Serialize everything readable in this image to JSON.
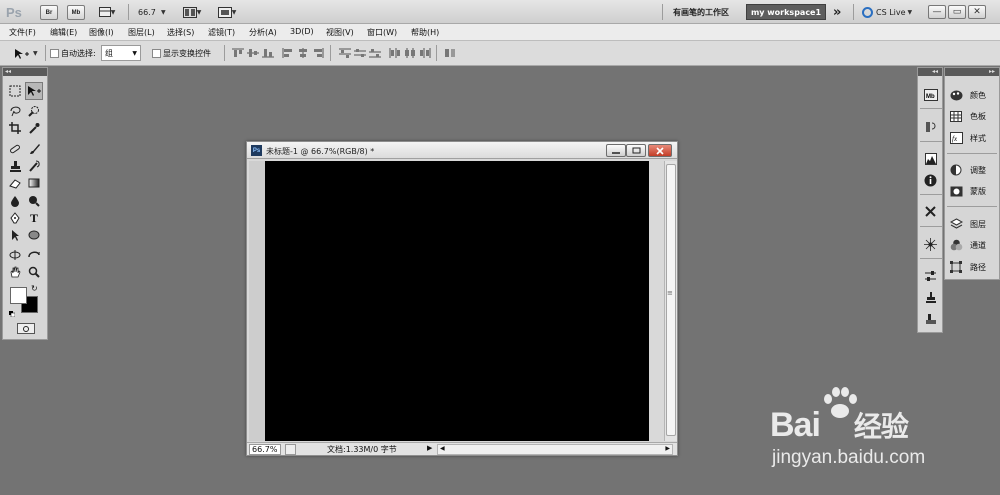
{
  "app": {
    "logo": "Ps",
    "bridge_label": "Br",
    "minibridge_label": "Mb",
    "zoom_value": "66.7",
    "workspace_link": "有画笔的工作区",
    "workspace_active": "my workspace1",
    "more_label": "»",
    "cs_live": "CS Live",
    "window_controls": [
      "—",
      "▭",
      "✕"
    ]
  },
  "menu": {
    "items": [
      "文件(F)",
      "编辑(E)",
      "图像(I)",
      "图层(L)",
      "选择(S)",
      "滤镜(T)",
      "分析(A)",
      "3D(D)",
      "视图(V)",
      "窗口(W)",
      "帮助(H)"
    ]
  },
  "options": {
    "auto_select_label": "自动选择:",
    "auto_select_value": "组",
    "transform_label": "显示变换控件"
  },
  "right_panel": {
    "items": [
      "颜色",
      "色板",
      "样式",
      "调整",
      "蒙版",
      "图层",
      "通道",
      "路径"
    ]
  },
  "document": {
    "title": "未标题-1 @ 66.7%(RGB/8) *",
    "ps_badge": "Ps",
    "zoom": "66.7%",
    "info": "文档:1.33M/0 字节",
    "canvas_color": "#000000"
  },
  "watermark": {
    "brand": "Bai",
    "brand_cn": "经验",
    "url": "jingyan.baidu.com"
  },
  "colors": {
    "background": "#737373",
    "foreground_swatch": "#ffffff",
    "background_swatch": "#000000",
    "close_button": "#c9452e"
  }
}
